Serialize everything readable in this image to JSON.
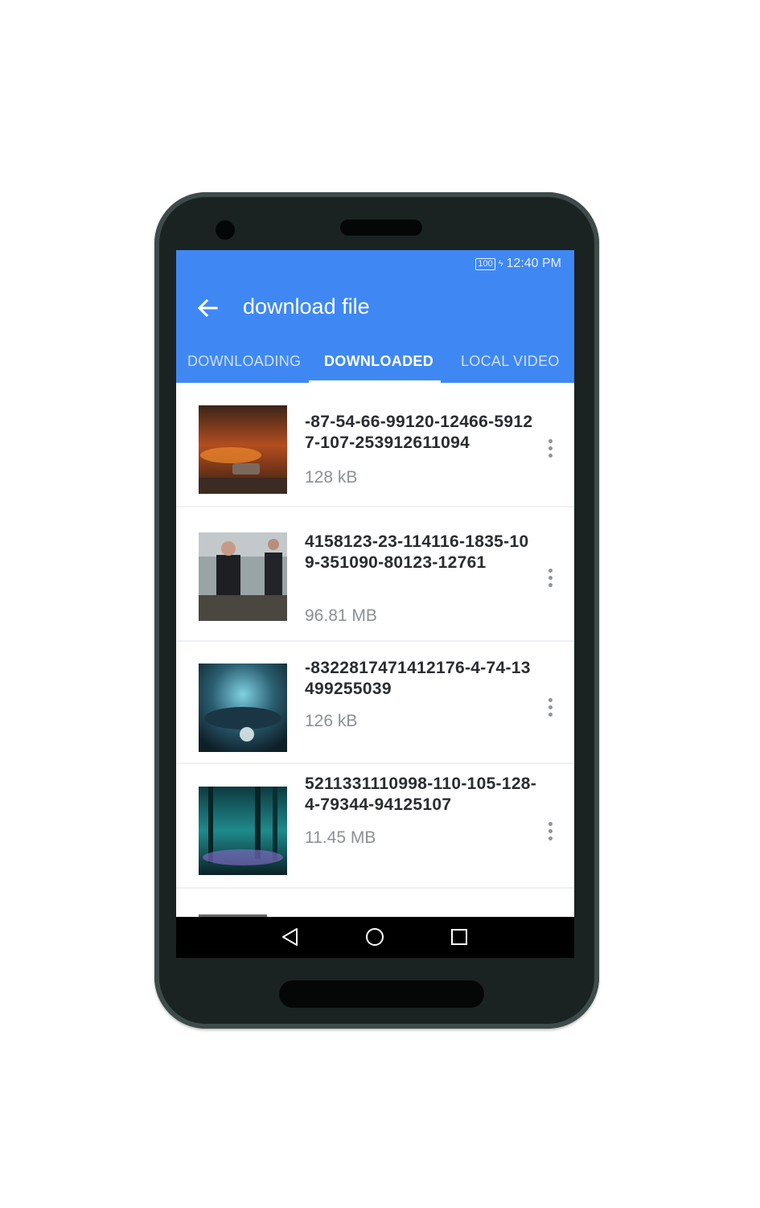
{
  "status": {
    "battery": "100",
    "time": "12:40 PM"
  },
  "appbar": {
    "title": "download file"
  },
  "tabs": [
    {
      "label": "DOWNLOADING",
      "active": false
    },
    {
      "label": "DOWNLOADED",
      "active": true
    },
    {
      "label": "LOCAL VIDEO",
      "active": false
    }
  ],
  "files": [
    {
      "name": "-87-54-66-99120-12466-59127-107-253912611094",
      "size": "128 kB"
    },
    {
      "name": "4158123-23-114116-1835-109-351090-80123-12761",
      "size": "96.81 MB"
    },
    {
      "name": "-8322817471412176-4-74-13499255039",
      "size": "126 kB"
    },
    {
      "name": "5211331110998-110-105-128-4-79344-94125107",
      "size": "11.45 MB"
    }
  ],
  "icons": {
    "back": "arrow-left-icon",
    "more": "more-vertical-icon",
    "nav": [
      "back-triangle-icon",
      "home-circle-icon",
      "recents-square-icon"
    ]
  },
  "colors": {
    "appbar": "#3f88f4",
    "navbar": "#000000"
  }
}
